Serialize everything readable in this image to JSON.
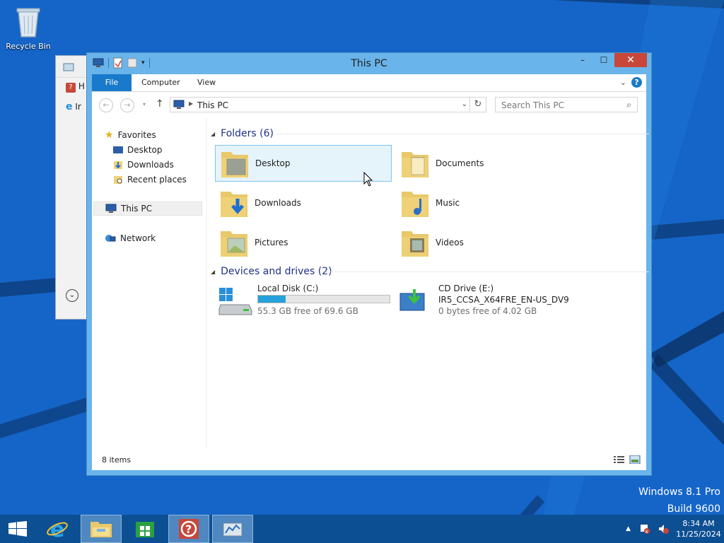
{
  "desktop": {
    "recycle_bin_label": "Recycle Bin",
    "watermark_line1": "Windows 8.1 Pro",
    "watermark_line2": "Build 9600"
  },
  "back_window": {
    "row1_text": "H",
    "row2_text": "Ir"
  },
  "window": {
    "title": "This PC",
    "minimize_glyph": "–",
    "maximize_glyph": "☐",
    "close_glyph": "✕"
  },
  "ribbon": {
    "tabs": [
      "File",
      "Computer",
      "View"
    ]
  },
  "address": {
    "crumb": "This PC",
    "search_placeholder": "Search This PC"
  },
  "nav_pane": {
    "favorites": "Favorites",
    "favorites_items": [
      "Desktop",
      "Downloads",
      "Recent places"
    ],
    "this_pc": "This PC",
    "network": "Network"
  },
  "content": {
    "folders_header": "Folders (6)",
    "folders": [
      "Desktop",
      "Documents",
      "Downloads",
      "Music",
      "Pictures",
      "Videos"
    ],
    "devices_header": "Devices and drives (2)",
    "drives": [
      {
        "name": "Local Disk (C:)",
        "free": "55.3 GB free of 69.6 GB",
        "used_fraction": 0.21
      },
      {
        "name": "CD Drive (E:)",
        "label": "IR5_CCSA_X64FRE_EN-US_DV9",
        "free": "0 bytes free of 4.02 GB"
      }
    ]
  },
  "status": {
    "items_text": "8 items"
  },
  "taskbar": {
    "time": "8:34 AM",
    "date": "11/25/2024"
  },
  "colors": {
    "accent": "#1979ca",
    "title_bar": "#69b4ea",
    "close": "#c7473b",
    "taskbar": "#0d4f93"
  }
}
